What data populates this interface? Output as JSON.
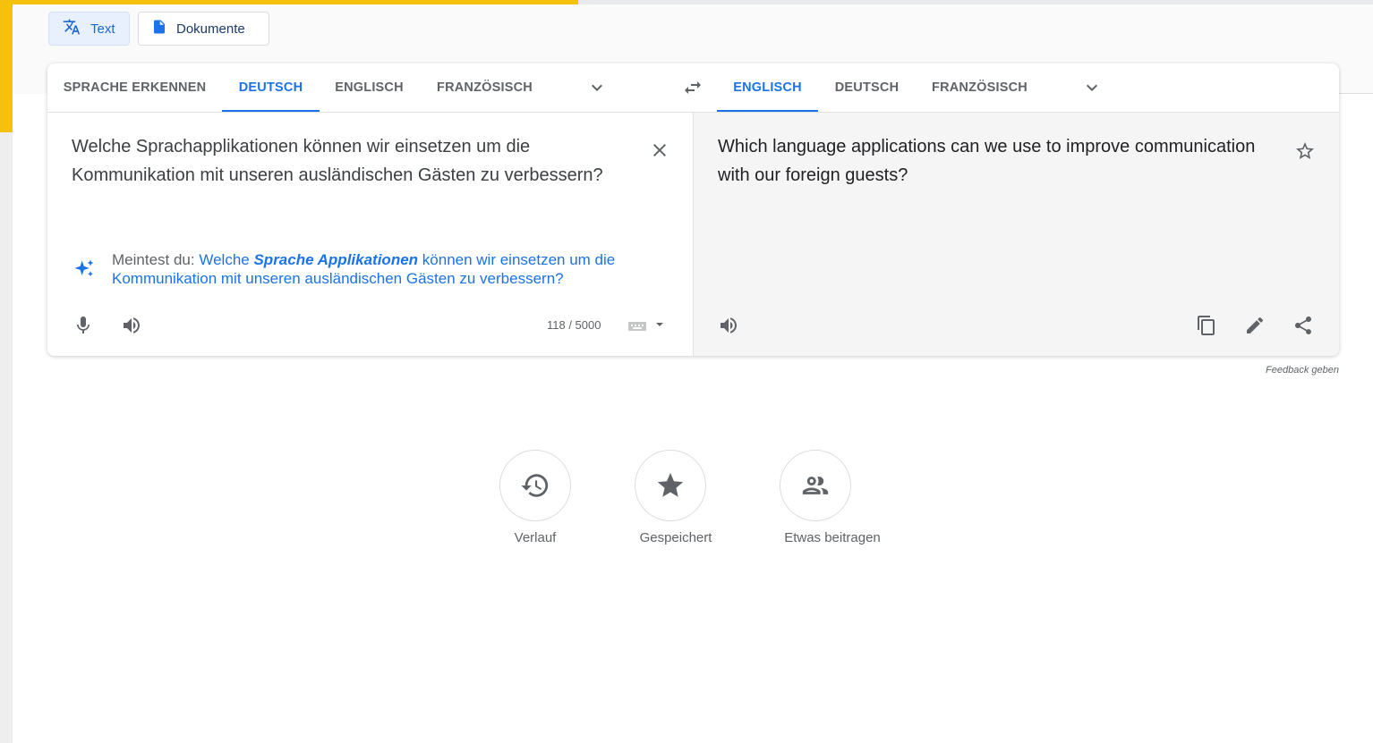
{
  "mode_tabs": {
    "text": "Text",
    "documents": "Dokumente"
  },
  "source_langs": [
    "SPRACHE ERKENNEN",
    "DEUTSCH",
    "ENGLISCH",
    "FRANZÖSISCH"
  ],
  "source_active_index": 1,
  "target_langs": [
    "ENGLISCH",
    "DEUTSCH",
    "FRANZÖSISCH"
  ],
  "target_active_index": 0,
  "source": {
    "text": "Welche Sprachapplikationen können wir einsetzen um die Kommunikation mit unseren ausländischen Gästen zu verbessern?",
    "suggestion_label": "Meintest du:",
    "suggestion_pre": "Welche",
    "suggestion_emphasis": "Sprache Applikationen",
    "suggestion_post": "können wir einsetzen um die Kommunikation mit unseren ausländischen Gästen zu verbessern?",
    "char_count": "118 / 5000"
  },
  "target": {
    "text": "Which language applications can we use to improve communication with our foreign guests?"
  },
  "feedback": "Feedback geben",
  "bottom_actions": {
    "history": "Verlauf",
    "saved": "Gespeichert",
    "contribute": "Etwas beitragen"
  },
  "icons": [
    "translate-icon",
    "document-icon",
    "chevron-down-icon",
    "swap-icon",
    "close-icon",
    "sparkle-icon",
    "mic-icon",
    "speaker-icon",
    "keyboard-icon",
    "dropdown-arrow-icon",
    "star-outline-icon",
    "copy-icon",
    "edit-icon",
    "share-icon",
    "history-icon",
    "star-icon",
    "people-icon"
  ],
  "colors": {
    "accent": "#1a73e8",
    "yellow": "#f4c20d",
    "target_bg": "#f5f5f5"
  }
}
